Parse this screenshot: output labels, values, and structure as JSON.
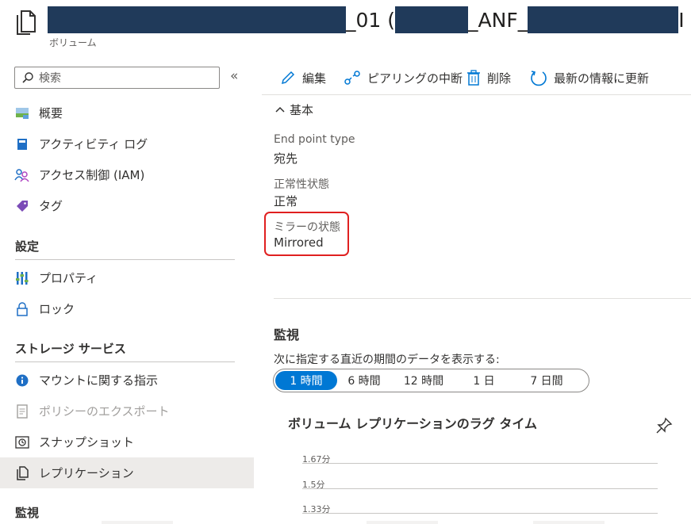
{
  "header": {
    "title_part1": "_01 (",
    "title_part2": "_ANF_",
    "title_part3": "I",
    "subtitle": "ボリューム"
  },
  "sidebar": {
    "search_placeholder": "検索",
    "collapse": "«",
    "items": [
      {
        "label": "概要",
        "icon": "overview-icon"
      },
      {
        "label": "アクティビティ ログ",
        "icon": "activity-log-icon"
      },
      {
        "label": "アクセス制御 (IAM)",
        "icon": "iam-icon"
      },
      {
        "label": "タグ",
        "icon": "tag-icon"
      }
    ],
    "section_settings": "設定",
    "settings_items": [
      {
        "label": "プロパティ",
        "icon": "properties-icon"
      },
      {
        "label": "ロック",
        "icon": "lock-icon"
      }
    ],
    "section_storage": "ストレージ サービス",
    "storage_items": [
      {
        "label": "マウントに関する指示",
        "icon": "info-icon"
      },
      {
        "label": "ポリシーのエクスポート",
        "icon": "export-policy-icon"
      },
      {
        "label": "スナップショット",
        "icon": "snapshot-icon"
      },
      {
        "label": "レプリケーション",
        "icon": "replication-icon"
      }
    ],
    "section_monitoring": "監視"
  },
  "toolbar": {
    "edit": "編集",
    "break_peering": "ピアリングの中断",
    "delete": "削除",
    "refresh": "最新の情報に更新"
  },
  "essentials": {
    "header": "基本",
    "endpoint_label": "End point type",
    "endpoint_value": "宛先",
    "health_label": "正常性状態",
    "health_value": "正常",
    "mirror_label": "ミラーの状態",
    "mirror_value": "Mirrored"
  },
  "monitoring": {
    "title": "監視",
    "description": "次に指定する直近の期間のデータを表示する:",
    "ranges": [
      "1 時間",
      "6 時間",
      "12 時間",
      "1 日",
      "7 日間"
    ],
    "selected_range": "1 時間",
    "chart_title": "ボリューム レプリケーションのラグ タイム"
  },
  "chart_data": {
    "type": "line",
    "title": "ボリューム レプリケーションのラグ タイム",
    "y_ticks": [
      "1.67分",
      "1.5分",
      "1.33分"
    ],
    "series": []
  },
  "colors": {
    "accent": "#0078d4",
    "highlight_border": "#e02020",
    "redaction": "#203a5a"
  }
}
